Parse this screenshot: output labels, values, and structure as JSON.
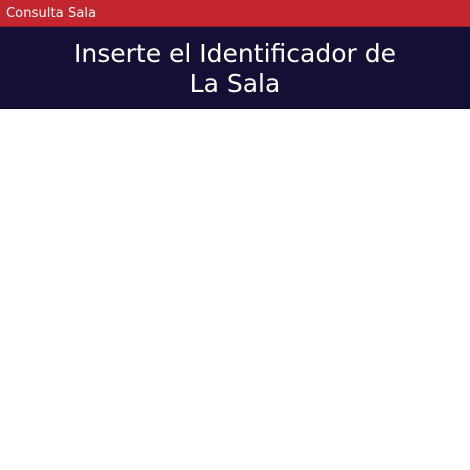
{
  "window": {
    "title": "Consulta Sala"
  },
  "header": {
    "heading": "Inserte el Identificador de\nLa Sala"
  },
  "colors": {
    "title_bar": "#c3262e",
    "header_bg": "#130f35",
    "content_bg": "#ffffff",
    "text": "#ffffff"
  }
}
